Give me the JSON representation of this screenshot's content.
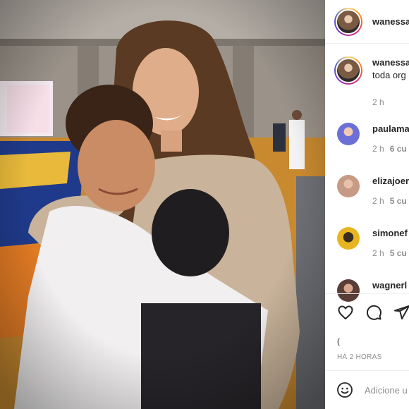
{
  "post": {
    "photo_alt": "photo",
    "username": "wanessa",
    "caption_user": "wanessa",
    "caption_text": "toda org",
    "caption_time": "2 h"
  },
  "comments": [
    {
      "user": "paulama",
      "time": "2 h",
      "likes": "6 cu",
      "avatar_color": "#6b6fd6"
    },
    {
      "user": "elizajoen",
      "time": "2 h",
      "likes": "5 cu",
      "avatar_color": "#c79a86"
    },
    {
      "user": "simonef",
      "time": "2 h",
      "likes": "5 cu",
      "avatar_color": "#e8b520"
    },
    {
      "user": "wagnerl",
      "time": "",
      "likes": "",
      "avatar_color": "#5a3d36"
    }
  ],
  "actions": {
    "like_icon": "heart-icon",
    "comment_icon": "comment-icon",
    "share_icon": "send-icon",
    "likes_text": "(",
    "time_ago": "HÁ 2 HORAS"
  },
  "add_comment": {
    "emoji_icon": "emoji-icon",
    "placeholder": "Adicione u"
  }
}
